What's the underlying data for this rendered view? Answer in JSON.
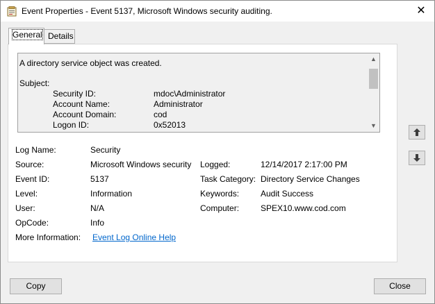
{
  "window": {
    "title": "Event Properties - Event 5137, Microsoft Windows security auditing."
  },
  "tabs": [
    {
      "label": "General",
      "active": true
    },
    {
      "label": "Details",
      "active": false
    }
  ],
  "message": {
    "line1": "A directory service object was created.",
    "subject_label": "Subject:",
    "rows": [
      {
        "key": "Security ID:",
        "value": "mdoc\\Administrator"
      },
      {
        "key": "Account Name:",
        "value": "Administrator"
      },
      {
        "key": "Account Domain:",
        "value": "cod"
      },
      {
        "key": "Logon ID:",
        "value": "0x52013"
      }
    ]
  },
  "fields": {
    "log_name_label": "Log Name:",
    "log_name": "Security",
    "source_label": "Source:",
    "source": "Microsoft Windows security",
    "logged_label": "Logged:",
    "logged": "12/14/2017 2:17:00 PM",
    "event_id_label": "Event ID:",
    "event_id": "5137",
    "task_category_label": "Task Category:",
    "task_category": "Directory Service Changes",
    "level_label": "Level:",
    "level": "Information",
    "keywords_label": "Keywords:",
    "keywords": "Audit Success",
    "user_label": "User:",
    "user": "N/A",
    "computer_label": "Computer:",
    "computer": "SPEX10.www.cod.com",
    "opcode_label": "OpCode:",
    "opcode": "Info",
    "more_info_label": "More Information:",
    "more_info_link": "Event Log Online Help"
  },
  "buttons": {
    "copy": "Copy",
    "close": "Close"
  },
  "icons": {
    "app": "event-viewer-icon",
    "close": "close-icon",
    "up": "arrow-up-icon",
    "down": "arrow-down-icon"
  }
}
